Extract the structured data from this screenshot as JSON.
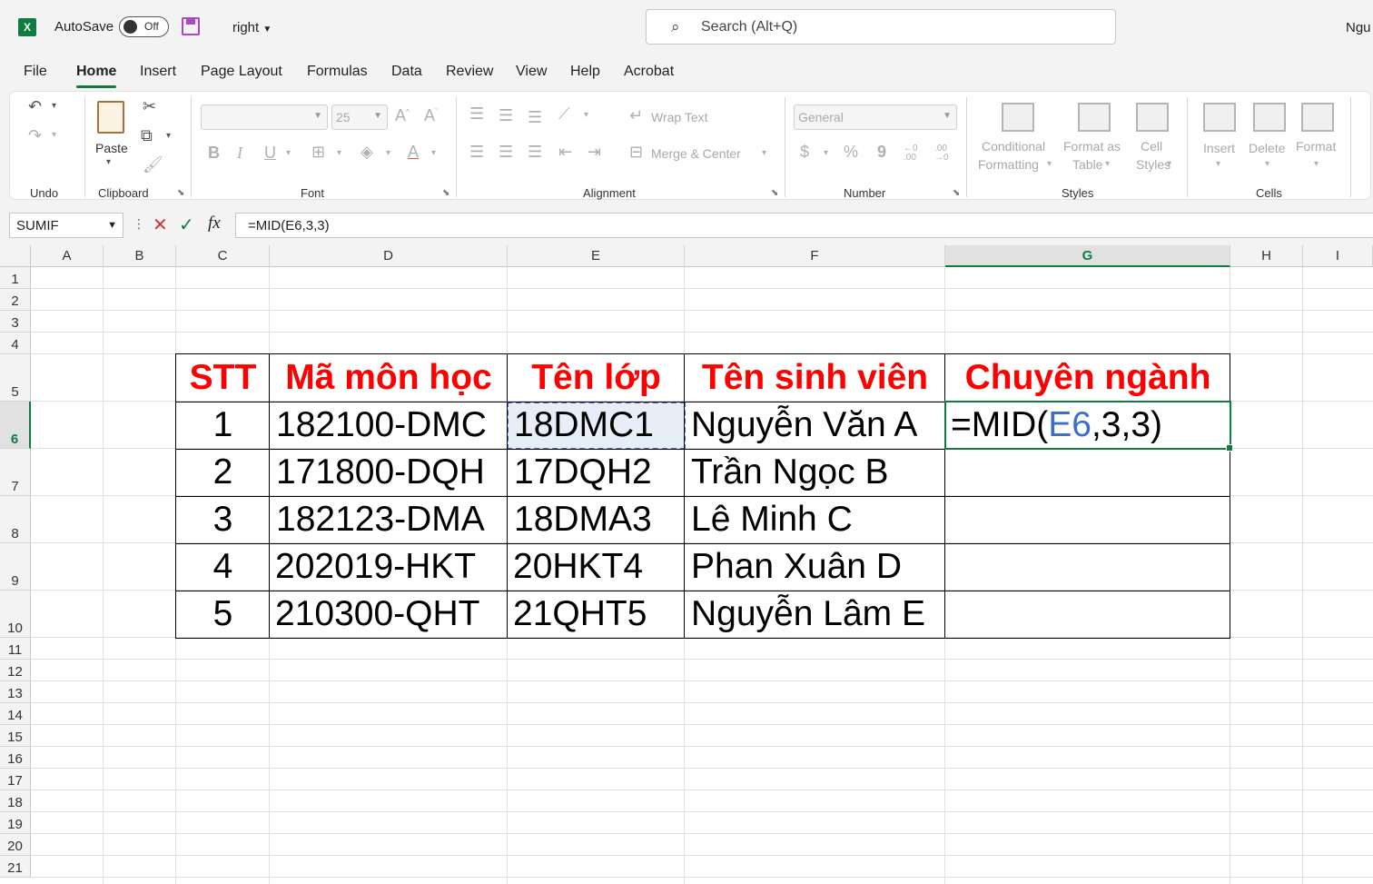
{
  "titlebar": {
    "app_icon": "X",
    "autosave_label": "AutoSave",
    "autosave_state": "Off",
    "doc_name": "right",
    "search_placeholder": "Search (Alt+Q)",
    "user_name": "Ngu"
  },
  "menu": {
    "tabs": [
      "File",
      "Home",
      "Insert",
      "Page Layout",
      "Formulas",
      "Data",
      "Review",
      "View",
      "Help",
      "Acrobat"
    ],
    "active": "Home"
  },
  "ribbon": {
    "groups": {
      "undo": "Undo",
      "clipboard": "Clipboard",
      "font": "Font",
      "alignment": "Alignment",
      "number": "Number",
      "styles": "Styles",
      "cells": "Cells"
    },
    "paste": "Paste",
    "font_size": "25",
    "bold": "B",
    "italic": "I",
    "underline": "U",
    "wrap_text": "Wrap Text",
    "merge_center": "Merge & Center",
    "number_format": "General",
    "currency": "$",
    "percent": "%",
    "comma": "9",
    "inc_decimal": "←0 .00",
    "dec_decimal": ".00 →0",
    "conditional_formatting_1": "Conditional",
    "conditional_formatting_2": "Formatting",
    "format_as_table_1": "Format as",
    "format_as_table_2": "Table",
    "cell_styles_1": "Cell",
    "cell_styles_2": "Styles",
    "insert": "Insert",
    "delete": "Delete",
    "format": "Format"
  },
  "formula_bar": {
    "name_box": "SUMIF",
    "formula": "=MID(E6,3,3)"
  },
  "sheet": {
    "columns": [
      "A",
      "B",
      "C",
      "D",
      "E",
      "F",
      "G",
      "H",
      "I"
    ],
    "selected_column": "G",
    "rows": [
      "1",
      "2",
      "3",
      "4",
      "5",
      "6",
      "7",
      "8",
      "9",
      "10",
      "11",
      "12",
      "13",
      "14",
      "15",
      "16",
      "17",
      "18",
      "19",
      "20",
      "21"
    ],
    "selected_row": "6",
    "table_headers": [
      "STT",
      "Mã môn học",
      "Tên lớp",
      "Tên sinh viên",
      "Chuyên ngành"
    ],
    "table_rows": [
      [
        "1",
        "182100-DMC",
        "18DMC1",
        "Nguyễn Văn A",
        ""
      ],
      [
        "2",
        "171800-DQH",
        "17DQH2",
        "Trần Ngọc B",
        ""
      ],
      [
        "3",
        "182123-DMA",
        "18DMA3",
        "Lê Minh C",
        ""
      ],
      [
        "4",
        "202019-HKT",
        "20HKT4",
        "Phan Xuân D",
        ""
      ],
      [
        "5",
        "210300-QHT",
        "21QHT5",
        "Nguyễn Lâm E",
        ""
      ]
    ],
    "editing_formula": {
      "prefix": "=MID(",
      "ref": "E6",
      "suffix": ",3,3)"
    }
  },
  "colors": {
    "accent": "#107c41",
    "header_text": "#ff0000",
    "ref_blue": "#3b6fc9"
  }
}
